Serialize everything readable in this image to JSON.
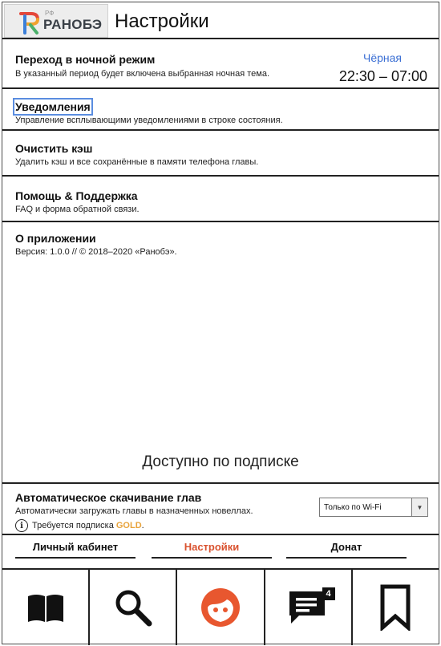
{
  "header": {
    "logo_prefix": "РФ",
    "logo_text": "РАНОБЭ",
    "title": "Настройки"
  },
  "settings": [
    {
      "title": "Переход в ночной режим",
      "subtitle": "В указанный период будет включена выбранная ночная тема.",
      "value": "Чёрная",
      "time": "22:30 – 07:00"
    },
    {
      "title": "Уведомления",
      "subtitle": "Управление всплывающими уведомлениями в строке состояния."
    },
    {
      "title": "Очистить кэш",
      "subtitle": "Удалить кэш и все сохранённые в памяти телефона главы."
    },
    {
      "title": "Помощь & Поддержка",
      "subtitle": "FAQ и форма обратной связи."
    },
    {
      "title": "О приложении",
      "subtitle": "Версия: 1.0.0 // © 2018–2020 «Ранобэ»."
    }
  ],
  "subscription": {
    "heading": "Доступно по подписке",
    "title": "Автоматическое скачивание глав",
    "description": "Автоматически загружать главы в назначенных новеллах.",
    "note": "Требуется подписка",
    "note_highlight": "GOLD",
    "note_end": ".",
    "select_value": "Только по Wi-Fi"
  },
  "tabs": [
    {
      "label": "Личный кабинет",
      "active": false
    },
    {
      "label": "Настройки",
      "active": true
    },
    {
      "label": "Донат",
      "active": false
    }
  ],
  "bottom_nav": [
    {
      "icon": "book-icon"
    },
    {
      "icon": "search-icon"
    },
    {
      "icon": "profile-face-icon",
      "color": "#e8572f"
    },
    {
      "icon": "chat-icon",
      "badge": "4"
    },
    {
      "icon": "bookmark-icon"
    }
  ],
  "colors": {
    "accent": "#d9522f",
    "link": "#3b6fd4",
    "gold": "#e8a33b"
  }
}
